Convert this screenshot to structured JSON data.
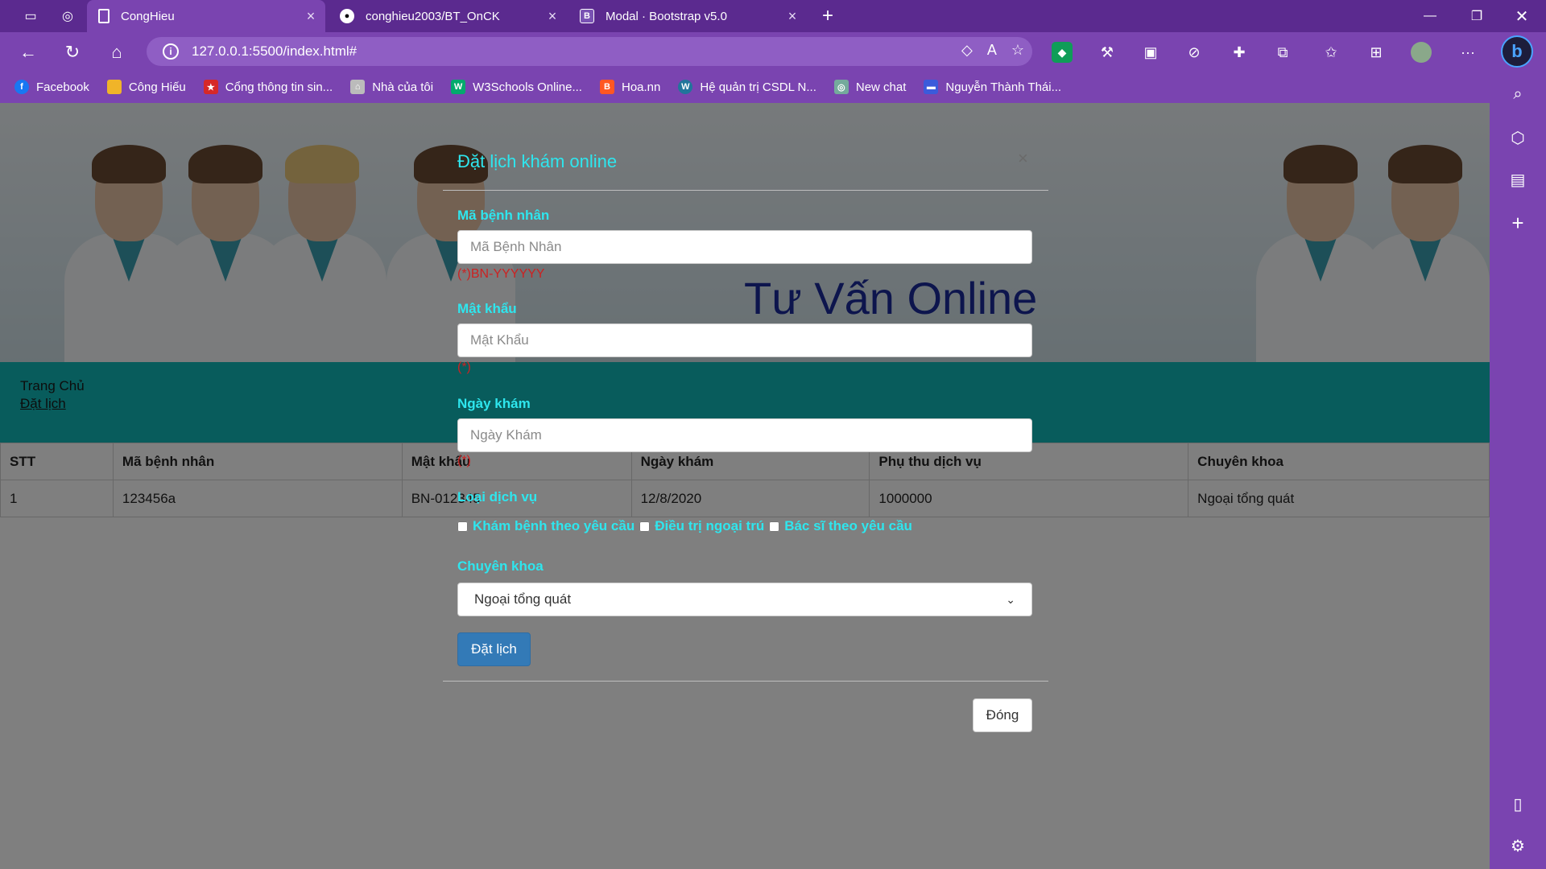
{
  "browser": {
    "tabs": [
      {
        "title": "CongHieu",
        "favicon": "document-icon"
      },
      {
        "title": "conghieu2003/BT_OnCK",
        "favicon": "github-icon"
      },
      {
        "title": "Modal · Bootstrap v5.0",
        "favicon": "bootstrap-icon"
      }
    ],
    "url": "127.0.0.1:5500/index.html#",
    "bookmarks": [
      {
        "label": "Facebook",
        "icon": "facebook-icon",
        "color": "#1877f2"
      },
      {
        "label": "Công Hiếu",
        "icon": "folder-icon",
        "color": "#f0b429"
      },
      {
        "label": "Cổng thông tin sin...",
        "icon": "portal-icon",
        "color": "#d62828"
      },
      {
        "label": "Nhà của tôi",
        "icon": "home-icon",
        "color": "#bbbbbb"
      },
      {
        "label": "W3Schools Online...",
        "icon": "w3schools-icon",
        "color": "#04aa6d"
      },
      {
        "label": "Hoa.nn",
        "icon": "blogger-icon",
        "color": "#ff5722"
      },
      {
        "label": "Hệ quản trị CSDL N...",
        "icon": "wordpress-icon",
        "color": "#21759b"
      },
      {
        "label": "New chat",
        "icon": "chatgpt-icon",
        "color": "#74aa9c"
      },
      {
        "label": "Nguyễn Thành Thái...",
        "icon": "site-icon",
        "color": "#3b5bdb"
      }
    ]
  },
  "page": {
    "banner_title": "Tư Vấn Online",
    "nav": {
      "home": "Trang Chủ",
      "booking": "Đặt lịch"
    },
    "table": {
      "headers": [
        "STT",
        "Mã bệnh nhân",
        "Mật khẩu",
        "Ngày khám",
        "Phụ thu dịch vụ",
        "Chuyên khoa"
      ],
      "rows": [
        [
          "1",
          "123456a",
          "BN-012345",
          "12/8/2020",
          "1000000",
          "Ngoại tổng quát"
        ]
      ]
    }
  },
  "modal": {
    "title": "Đặt lịch khám online",
    "close_symbol": "×",
    "patient_id": {
      "label": "Mã bệnh nhân",
      "placeholder": "Mã Bệnh Nhân",
      "hint": "(*)BN-YYYYYY"
    },
    "password": {
      "label": "Mật khẩu",
      "placeholder": "Mật Khẩu",
      "hint": "(*)"
    },
    "date": {
      "label": "Ngày khám",
      "placeholder": "Ngày Khám",
      "hint": "(*)"
    },
    "services": {
      "label": "Loại dịch vụ",
      "options": [
        "Khám bệnh theo yêu cầu",
        "Điều trị ngoại trú",
        "Bác sĩ theo yêu cầu"
      ]
    },
    "specialty": {
      "label": "Chuyên khoa",
      "selected": "Ngoại tổng quát"
    },
    "submit_label": "Đặt lịch",
    "close_label": "Đóng"
  },
  "colors": {
    "accent_label": "#2ee6ee",
    "browser": "#7a44b0",
    "teal_nav": "#10b8b8",
    "primary": "#337ab7"
  }
}
